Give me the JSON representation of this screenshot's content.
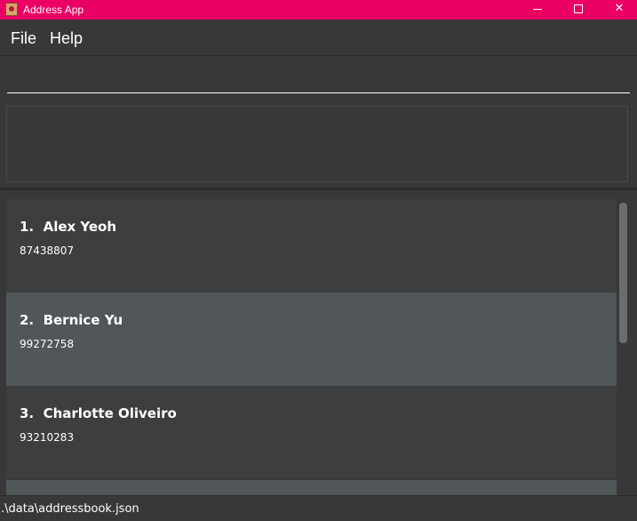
{
  "window": {
    "title": "Address App",
    "accent_color": "#ea0063",
    "minimize_icon": "minimize-icon",
    "maximize_icon": "maximize-icon",
    "close_symbol": "✕"
  },
  "menubar": {
    "items": [
      {
        "label": "File"
      },
      {
        "label": "Help"
      }
    ]
  },
  "command_box": {
    "value": "",
    "placeholder": ""
  },
  "result_display": {
    "text": ""
  },
  "person_list": {
    "persons": [
      {
        "name": "1.  Alex Yeoh",
        "phone": "87438807"
      },
      {
        "name": "2.  Bernice Yu",
        "phone": "99272758"
      },
      {
        "name": "3.  Charlotte Oliveiro",
        "phone": "93210283"
      }
    ]
  },
  "status_bar": {
    "save_location": ".\\data\\addressbook.json"
  }
}
